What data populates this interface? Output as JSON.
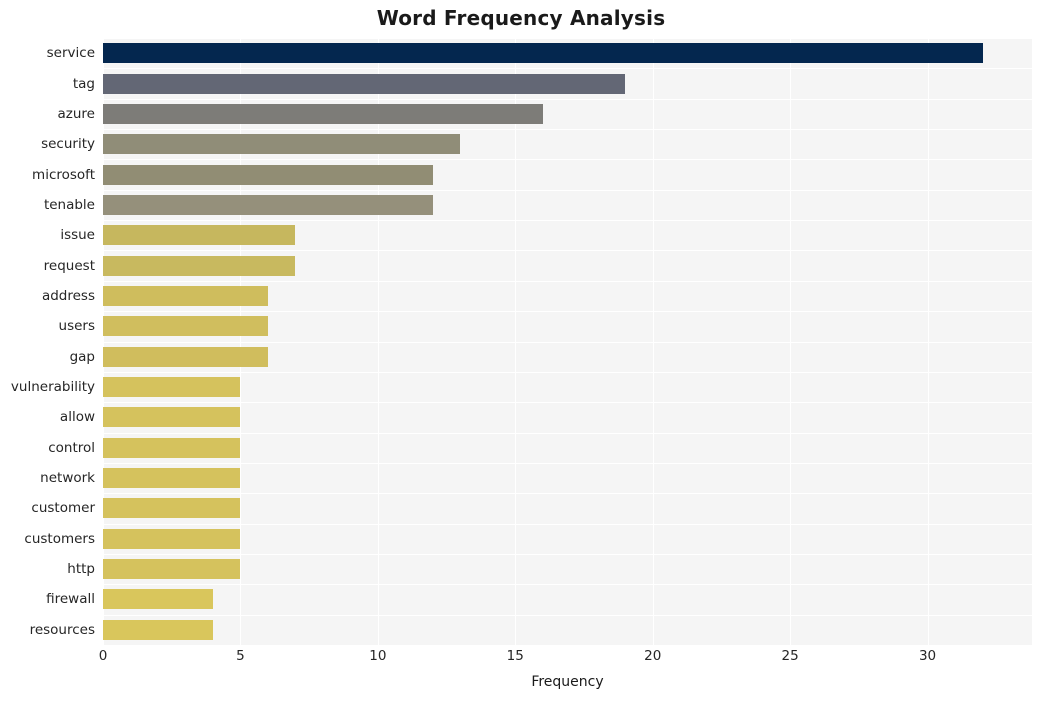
{
  "chart_data": {
    "type": "bar",
    "orientation": "horizontal",
    "title": "Word Frequency Analysis",
    "xlabel": "Frequency",
    "ylabel": "",
    "categories": [
      "service",
      "tag",
      "azure",
      "security",
      "microsoft",
      "tenable",
      "issue",
      "request",
      "address",
      "users",
      "gap",
      "vulnerability",
      "allow",
      "control",
      "network",
      "customer",
      "customers",
      "http",
      "firewall",
      "resources"
    ],
    "values": [
      32,
      19,
      16,
      13,
      12,
      12,
      7,
      7,
      6,
      6,
      6,
      5,
      5,
      5,
      5,
      5,
      5,
      5,
      4,
      4
    ],
    "bar_colors": [
      "#04274f",
      "#636775",
      "#7d7c78",
      "#908d78",
      "#918d74",
      "#95907b",
      "#c6b75e",
      "#c8b95f",
      "#cfbd5d",
      "#d0be5e",
      "#d0bd5d",
      "#d5c25d",
      "#d5c25d",
      "#d5c25d",
      "#d5c25d",
      "#d5c25d",
      "#d5c25d",
      "#d5c25d",
      "#d9c65c",
      "#d9c65c"
    ],
    "xlim": [
      0,
      33.8
    ],
    "xticks": [
      0,
      5,
      10,
      15,
      20,
      25,
      30
    ],
    "xticklabels": [
      "0",
      "5",
      "10",
      "15",
      "20",
      "25",
      "30"
    ],
    "grid": true,
    "grid_color": "#ffffff",
    "plot_background": "#f5f5f5",
    "figure_background": "#ffffff",
    "legend": null
  }
}
